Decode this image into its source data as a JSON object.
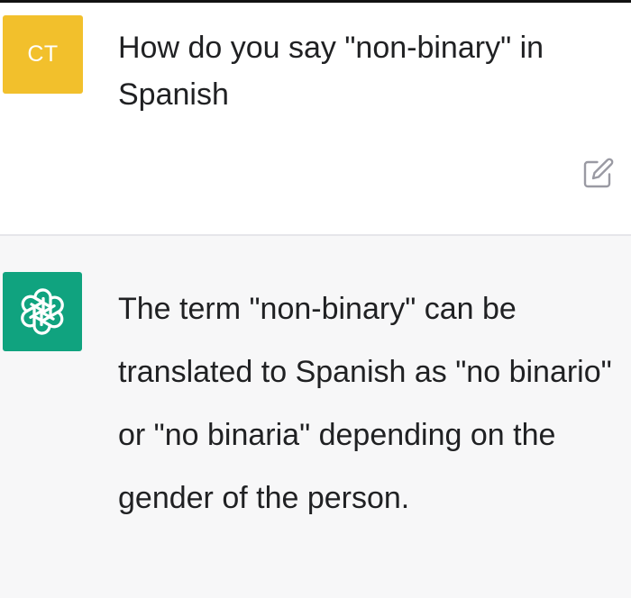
{
  "user_turn": {
    "avatar_initials": "CT",
    "avatar_color": "#f2c02c",
    "message": "How do you say \"non-binary\" in Spanish",
    "edit_icon": "edit-icon"
  },
  "assistant_turn": {
    "avatar_icon": "openai-logo-icon",
    "avatar_color": "#10a37f",
    "message": "The term \"non-binary\" can be translated to Spanish as \"no binario\" or \"no binaria\" depending on the gender of the person."
  }
}
